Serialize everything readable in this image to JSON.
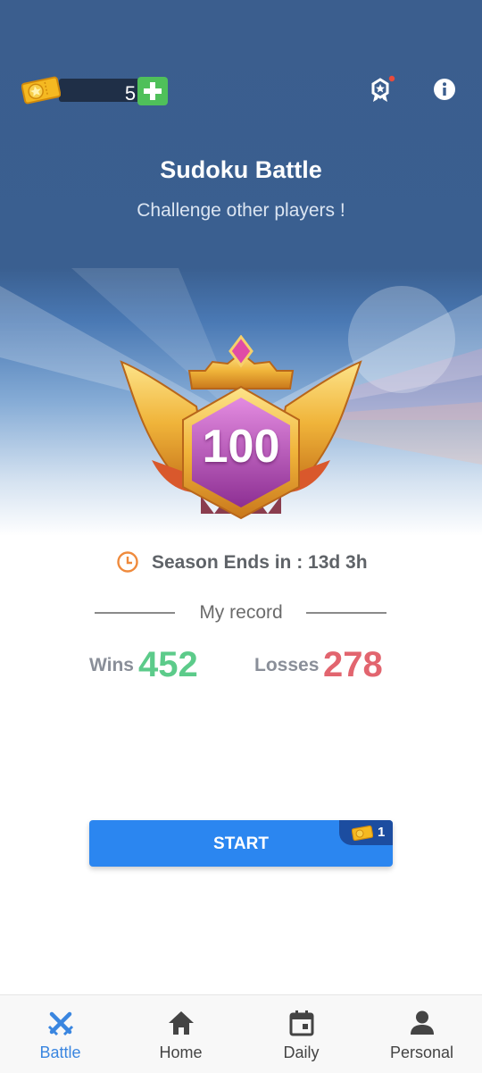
{
  "header": {
    "tickets": {
      "count": "5",
      "icon": "ticket-star-icon",
      "add_icon": "plus-icon"
    },
    "badge_icon": "rank-badge-icon",
    "info_icon": "info-icon",
    "title": "Sudoku Battle",
    "subtitle": "Challenge other players !"
  },
  "rank": {
    "value": "100"
  },
  "season": {
    "icon": "clock-icon",
    "text": "Season Ends in : 13d 3h"
  },
  "record": {
    "label": "My record",
    "wins_label": "Wins",
    "wins_value": "452",
    "losses_label": "Losses",
    "losses_value": "278"
  },
  "start": {
    "label": "START",
    "cost": "1",
    "cost_icon": "ticket-icon"
  },
  "nav": {
    "items": [
      {
        "label": "Battle",
        "icon": "crossed-swords-icon",
        "active": true
      },
      {
        "label": "Home",
        "icon": "home-icon",
        "active": false
      },
      {
        "label": "Daily",
        "icon": "calendar-icon",
        "active": false
      },
      {
        "label": "Personal",
        "icon": "person-icon",
        "active": false
      }
    ]
  },
  "colors": {
    "header_bg": "#3b5e8e",
    "accent": "#2b86f0",
    "wins": "#5ccb8a",
    "losses": "#e2656f",
    "nav_active": "#3a86e0"
  }
}
